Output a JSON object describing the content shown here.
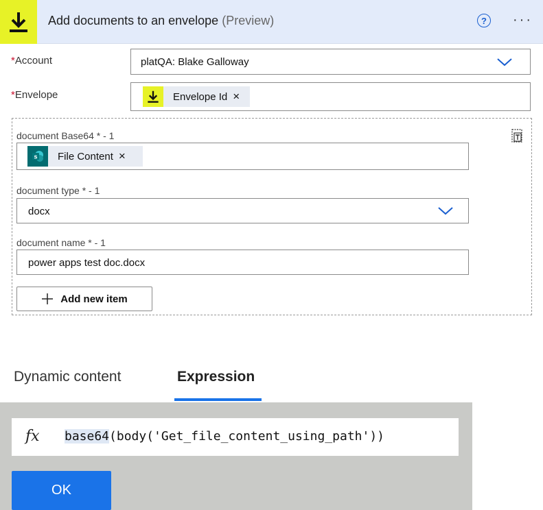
{
  "header": {
    "title": "Add documents to an envelope",
    "preview": "(Preview)",
    "help": "?",
    "more": "···",
    "accent_color": "#e7f227"
  },
  "account": {
    "label": "Account",
    "required_marker": "*",
    "value": "platQA: Blake Galloway"
  },
  "envelope": {
    "label": "Envelope",
    "required_marker": "*",
    "token_label": "Envelope Id",
    "remove": "×"
  },
  "documents": {
    "base64_label": "document Base64 * - 1",
    "base64_token_label": "File Content",
    "base64_token_remove": "×",
    "sp_icon_letter": "s",
    "type_label": "document type * - 1",
    "type_value": "docx",
    "name_label": "document name * - 1",
    "name_value": "power apps test doc.docx",
    "add_item_label": "Add new item"
  },
  "tabs": {
    "dynamic": "Dynamic content",
    "expression": "Expression"
  },
  "expression": {
    "fx": "fx",
    "function_name": "base64",
    "rest": "(body('Get_file_content_using_path'))",
    "ok_label": "OK"
  },
  "colors": {
    "primary": "#1a73e8",
    "required": "#c8102e",
    "sharepoint": "#036c70"
  }
}
